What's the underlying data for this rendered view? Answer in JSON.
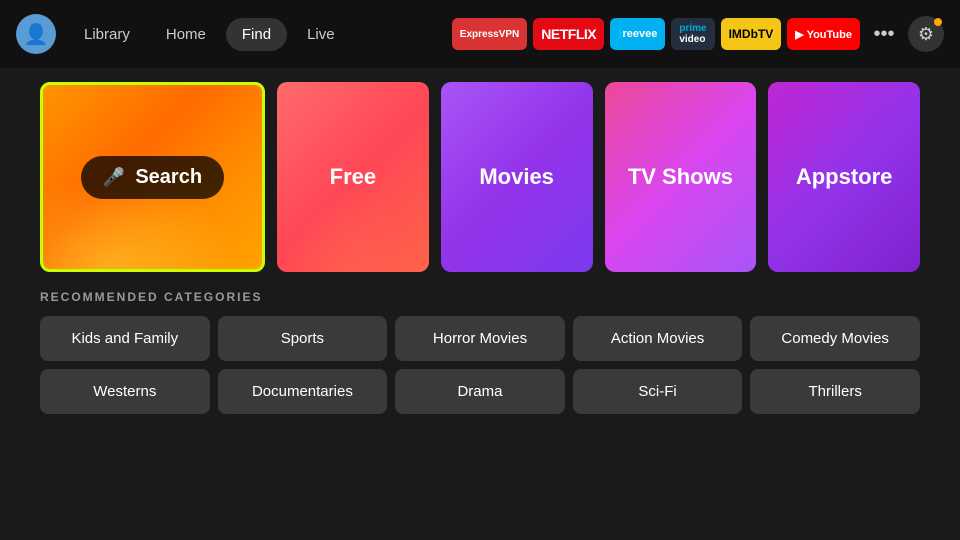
{
  "nav": {
    "avatar_icon": "👤",
    "links": [
      {
        "label": "Library",
        "active": false
      },
      {
        "label": "Home",
        "active": false
      },
      {
        "label": "Find",
        "active": true
      },
      {
        "label": "Live",
        "active": false
      }
    ],
    "apps": [
      {
        "id": "expressvpn",
        "label": "ExpressVPN",
        "class": "badge-expressvpn"
      },
      {
        "id": "netflix",
        "label": "NETFLIX",
        "class": "badge-netflix"
      },
      {
        "id": "freevee",
        "label": "freevee",
        "class": "badge-freevee"
      },
      {
        "id": "prime",
        "label": "prime video",
        "class": "badge-prime"
      },
      {
        "id": "imdb",
        "label": "IMDbTV",
        "class": "badge-imdb"
      },
      {
        "id": "youtube",
        "label": "▶ YouTube",
        "class": "badge-youtube"
      }
    ],
    "more_label": "•••",
    "settings_icon": "⚙"
  },
  "tiles": [
    {
      "id": "search",
      "label": "Search",
      "type": "search"
    },
    {
      "id": "free",
      "label": "Free",
      "type": "free"
    },
    {
      "id": "movies",
      "label": "Movies",
      "type": "movies"
    },
    {
      "id": "tvshows",
      "label": "TV Shows",
      "type": "tvshows"
    },
    {
      "id": "appstore",
      "label": "Appstore",
      "type": "appstore"
    }
  ],
  "recommended": {
    "section_title": "RECOMMENDED CATEGORIES",
    "row1": [
      "Kids and Family",
      "Sports",
      "Horror Movies",
      "Action Movies",
      "Comedy Movies"
    ],
    "row2": [
      "Westerns",
      "Documentaries",
      "Drama",
      "Sci-Fi",
      "Thrillers"
    ]
  }
}
